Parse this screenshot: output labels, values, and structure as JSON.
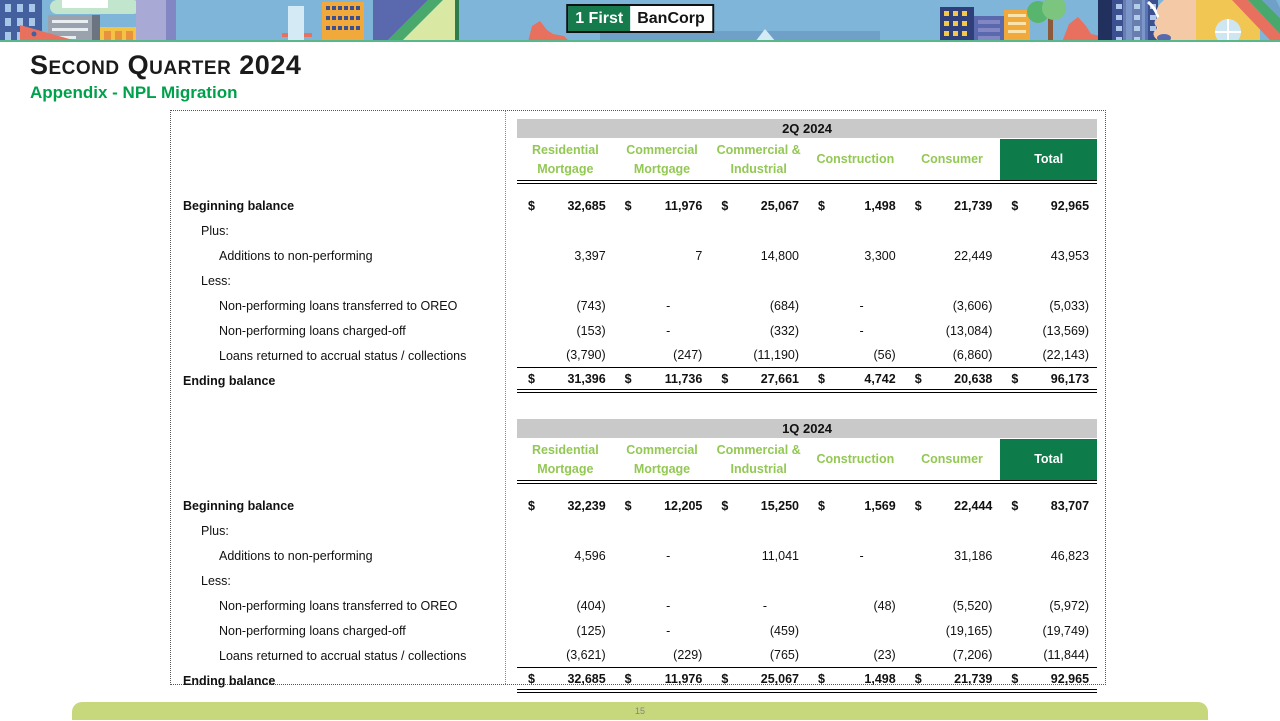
{
  "banner": {
    "logo": {
      "first": "1 First",
      "bancorp": "BanCorp"
    }
  },
  "page": {
    "title": "Second Quarter 2024",
    "subtitle": "Appendix - NPL Migration",
    "page_number": "15"
  },
  "colors": {
    "accent_green": "#00A14B",
    "column_header_green": "#93C854",
    "total_header_bg": "#0E7B4A",
    "period_band_gray": "#C9C9C9",
    "footer_bar_green": "#C7D77C"
  },
  "columns": [
    {
      "line1": "Residential",
      "line2": "Mortgage"
    },
    {
      "line1": "Commercial",
      "line2": "Mortgage"
    },
    {
      "line1": "Commercial &",
      "line2": "Industrial"
    },
    {
      "line1": "Construction",
      "line2": ""
    },
    {
      "line1": "Consumer",
      "line2": ""
    },
    {
      "line1": "Total",
      "line2": ""
    }
  ],
  "tables": [
    {
      "period": "2Q 2024",
      "rows": [
        {
          "label": "Beginning balance",
          "indent": 0,
          "bold": true,
          "dollar": true,
          "values": [
            "32,685",
            "11,976",
            "25,067",
            "1,498",
            "21,739",
            "92,965"
          ]
        },
        {
          "label": "Plus:",
          "indent": 1,
          "bold": false,
          "dollar": false,
          "values": [
            "",
            "",
            "",
            "",
            "",
            ""
          ]
        },
        {
          "label": "Additions to non-performing",
          "indent": 2,
          "bold": false,
          "dollar": false,
          "values": [
            "3,397",
            "7",
            "14,800",
            "3,300",
            "22,449",
            "43,953"
          ]
        },
        {
          "label": "Less:",
          "indent": 1,
          "bold": false,
          "dollar": false,
          "values": [
            "",
            "",
            "",
            "",
            "",
            ""
          ]
        },
        {
          "label": "Non-performing loans transferred to OREO",
          "indent": 2,
          "bold": false,
          "dollar": false,
          "values": [
            "(743)",
            "-",
            "(684)",
            "-",
            "(3,606)",
            "(5,033)"
          ]
        },
        {
          "label": "Non-performing loans charged-off",
          "indent": 2,
          "bold": false,
          "dollar": false,
          "values": [
            "(153)",
            "-",
            "(332)",
            "-",
            "(13,084)",
            "(13,569)"
          ]
        },
        {
          "label": "Loans returned to accrual status / collections",
          "indent": 2,
          "bold": false,
          "dollar": false,
          "values": [
            "(3,790)",
            "(247)",
            "(11,190)",
            "(56)",
            "(6,860)",
            "(22,143)"
          ],
          "rule_below": true
        },
        {
          "label": "Ending balance",
          "indent": 0,
          "bold": true,
          "dollar": true,
          "values": [
            "31,396",
            "11,736",
            "27,661",
            "4,742",
            "20,638",
            "96,173"
          ],
          "double_rule_below": true
        }
      ]
    },
    {
      "period": "1Q 2024",
      "rows": [
        {
          "label": "Beginning balance",
          "indent": 0,
          "bold": true,
          "dollar": true,
          "values": [
            "32,239",
            "12,205",
            "15,250",
            "1,569",
            "22,444",
            "83,707"
          ]
        },
        {
          "label": "Plus:",
          "indent": 1,
          "bold": false,
          "dollar": false,
          "values": [
            "",
            "",
            "",
            "",
            "",
            ""
          ]
        },
        {
          "label": "Additions to non-performing",
          "indent": 2,
          "bold": false,
          "dollar": false,
          "values": [
            "4,596",
            "-",
            "11,041",
            "-",
            "31,186",
            "46,823"
          ]
        },
        {
          "label": "Less:",
          "indent": 1,
          "bold": false,
          "dollar": false,
          "values": [
            "",
            "",
            "",
            "",
            "",
            ""
          ]
        },
        {
          "label": "Non-performing loans transferred to OREO",
          "indent": 2,
          "bold": false,
          "dollar": false,
          "values": [
            "(404)",
            "-",
            "-",
            "(48)",
            "(5,520)",
            "(5,972)"
          ]
        },
        {
          "label": "Non-performing loans charged-off",
          "indent": 2,
          "bold": false,
          "dollar": false,
          "values": [
            "(125)",
            "-",
            "(459)",
            "",
            "(19,165)",
            "(19,749)"
          ]
        },
        {
          "label": "Loans returned to accrual status / collections",
          "indent": 2,
          "bold": false,
          "dollar": false,
          "values": [
            "(3,621)",
            "(229)",
            "(765)",
            "(23)",
            "(7,206)",
            "(11,844)"
          ],
          "rule_below": true
        },
        {
          "label": "Ending balance",
          "indent": 0,
          "bold": true,
          "dollar": true,
          "values": [
            "32,685",
            "11,976",
            "25,067",
            "1,498",
            "21,739",
            "92,965"
          ],
          "double_rule_below": true
        }
      ]
    }
  ]
}
